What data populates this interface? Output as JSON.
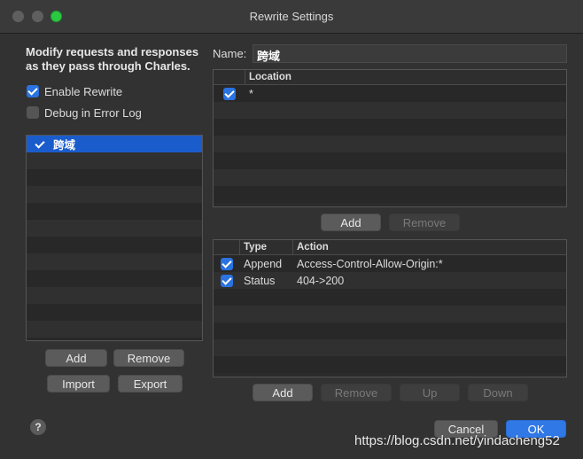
{
  "window": {
    "title": "Rewrite Settings"
  },
  "left": {
    "description": "Modify requests and responses as they pass through Charles.",
    "enable_rewrite": {
      "label": "Enable Rewrite",
      "checked": true
    },
    "debug_log": {
      "label": "Debug in Error Log",
      "checked": false
    },
    "sets": [
      {
        "name": "跨域",
        "checked": true,
        "selected": true
      }
    ],
    "buttons": {
      "add": "Add",
      "remove": "Remove",
      "import": "Import",
      "export": "Export"
    }
  },
  "right": {
    "name_label": "Name:",
    "name_value": "跨域",
    "locations": {
      "header": "Location",
      "rows": [
        {
          "checked": true,
          "location": "*"
        }
      ],
      "buttons": {
        "add": "Add",
        "remove": "Remove"
      }
    },
    "rules": {
      "headers": {
        "type": "Type",
        "action": "Action"
      },
      "rows": [
        {
          "checked": true,
          "type": "Append",
          "action": "Access-Control-Allow-Origin:*"
        },
        {
          "checked": true,
          "type": "Status",
          "action": "404->200"
        }
      ],
      "buttons": {
        "add": "Add",
        "remove": "Remove",
        "up": "Up",
        "down": "Down"
      }
    }
  },
  "footer": {
    "help": "?",
    "cancel": "Cancel",
    "ok": "OK"
  },
  "watermark": "https://blog.csdn.net/yindacheng52",
  "colors": {
    "accent": "#2f78e6",
    "selection": "#1a5ccc",
    "background": "#323232"
  }
}
